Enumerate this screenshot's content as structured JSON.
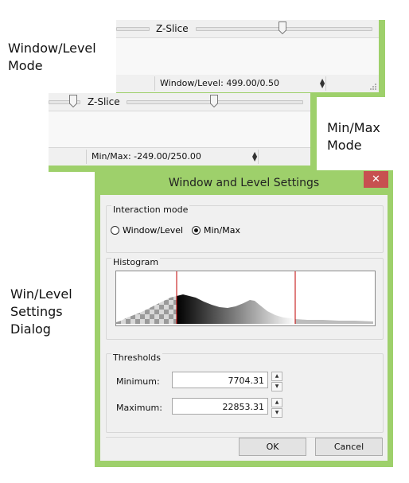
{
  "annotations": {
    "window_level_mode": "Window/Level\nMode",
    "min_max_mode": "Min/Max\nMode",
    "settings_dialog": "Win/Level\nSettings\nDialog"
  },
  "top_window": {
    "slider_label": "Z-Slice",
    "status_text": "Window/Level: 499.00/0.50"
  },
  "mid_window": {
    "slider_label": "Z-Slice",
    "status_text": "Min/Max: -249.00/250.00"
  },
  "dialog": {
    "title": "Window and Level Settings",
    "close_glyph": "✕",
    "interaction_mode": {
      "title": "Interaction mode",
      "options": [
        "Window/Level",
        "Min/Max"
      ],
      "selected": "Min/Max"
    },
    "histogram": {
      "title": "Histogram"
    },
    "thresholds": {
      "title": "Thresholds",
      "min_label": "Minimum:",
      "min_value": "7704.31",
      "max_label": "Maximum:",
      "max_value": "22853.31"
    },
    "ok_label": "OK",
    "cancel_label": "Cancel"
  },
  "colors": {
    "frame": "#9ed06b",
    "close": "#c75050",
    "marker": "#c00000"
  },
  "icons": [
    "slider-thumb-icon",
    "spin-arrows-icon",
    "size-grip-icon",
    "close-icon",
    "radio-icon"
  ]
}
